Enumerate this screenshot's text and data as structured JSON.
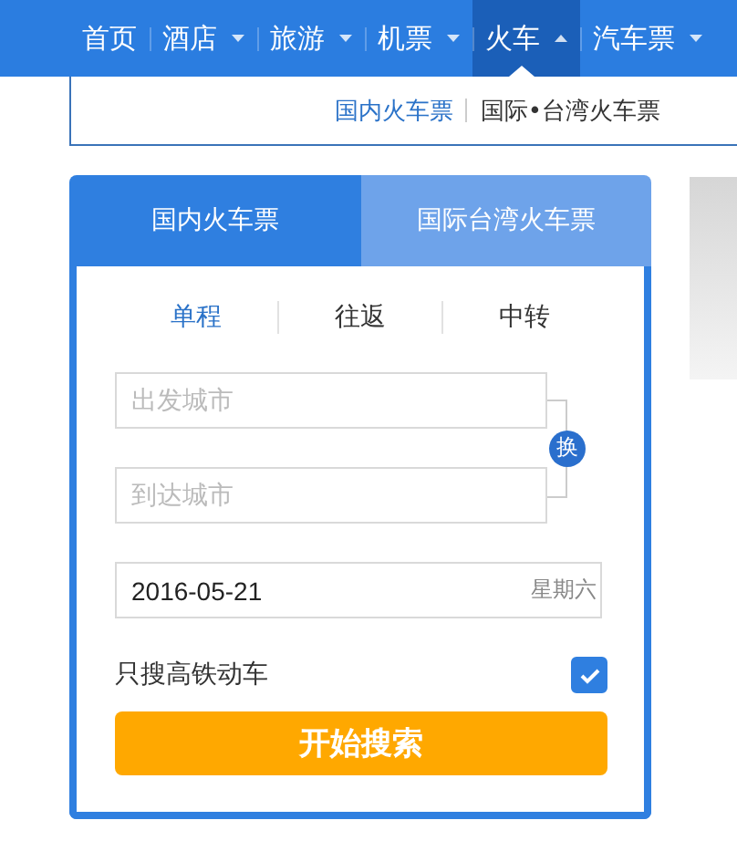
{
  "nav": {
    "items": [
      {
        "label": "首页",
        "dropdown": false,
        "selected": false
      },
      {
        "label": "酒店",
        "dropdown": true,
        "selected": false
      },
      {
        "label": "旅游",
        "dropdown": true,
        "selected": false
      },
      {
        "label": "机票",
        "dropdown": true,
        "selected": false
      },
      {
        "label": "火车",
        "dropdown": true,
        "selected": true
      },
      {
        "label": "汽车票",
        "dropdown": true,
        "selected": false
      }
    ]
  },
  "subnav": {
    "links": [
      {
        "label": "国内火车票",
        "selected": true
      },
      {
        "label": "国际•台湾火车票",
        "selected": false
      }
    ]
  },
  "card": {
    "tabs": [
      {
        "label": "国内火车票",
        "selected": true
      },
      {
        "label": "国际台湾火车票",
        "selected": false
      }
    ],
    "trip_types": [
      {
        "label": "单程",
        "selected": true
      },
      {
        "label": "往返",
        "selected": false
      },
      {
        "label": "中转",
        "selected": false
      }
    ],
    "from": {
      "placeholder": "出发城市"
    },
    "to": {
      "placeholder": "到达城市"
    },
    "swap": {
      "label": "换"
    },
    "date": {
      "value": "2016-05-21",
      "weekday": "星期六"
    },
    "high_speed_only": {
      "label": "只搜高铁动车",
      "checked": true
    },
    "search_button": "开始搜索"
  }
}
